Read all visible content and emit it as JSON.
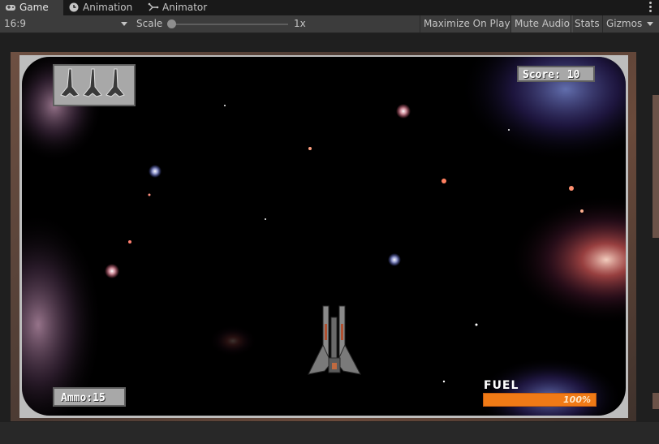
{
  "tabs": [
    {
      "label": "Game",
      "icon": "gamepad-icon",
      "active": true
    },
    {
      "label": "Animation",
      "icon": "clock-icon",
      "active": false
    },
    {
      "label": "Animator",
      "icon": "animator-icon",
      "active": false
    }
  ],
  "toolbar": {
    "aspect": "16:9",
    "scale_label": "Scale",
    "scale_value": "1x",
    "maximize_on_play": "Maximize On Play",
    "mute_audio": "Mute Audio",
    "stats": "Stats",
    "gizmos": "Gizmos"
  },
  "hud": {
    "score": "Score: 10",
    "ammo": "Ammo:15",
    "fuel_label": "FUEL",
    "fuel_percent_text": "100%",
    "fuel_level": 1.0,
    "lives": 3
  },
  "colors": {
    "fuel_bar": "#f07a16",
    "editor_bg": "#282828",
    "active_tab": "#3c3c3c"
  }
}
